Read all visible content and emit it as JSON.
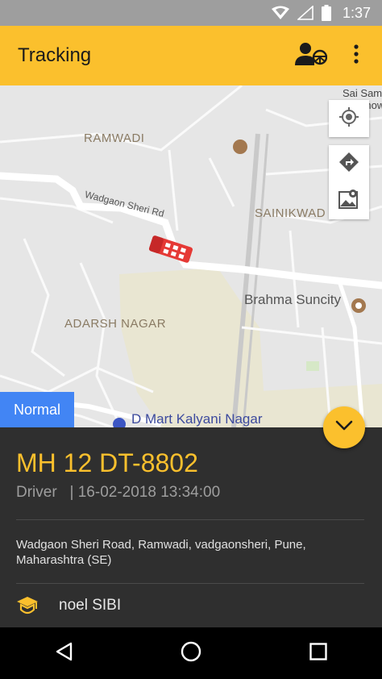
{
  "status_bar": {
    "time": "1:37",
    "icons": [
      "wifi-icon",
      "signal-icon",
      "battery-icon"
    ]
  },
  "app_bar": {
    "title": "Tracking",
    "actions": [
      "driver-icon",
      "more-vert-icon"
    ]
  },
  "map": {
    "labels": {
      "ramwadi": "RAMWADI",
      "sainikwadi": "SAINIKWAD",
      "adarsh_nagar": "ADARSH NAGAR",
      "brahma_suncity": "Brahma Suncity",
      "wadgaon_road": "Wadgaon Sheri Rd",
      "dmart": "D Mart Kalyani Nagar",
      "sai_sam": "Sai Sam",
      "chow": "Chow"
    },
    "controls": [
      "my-location-icon",
      "directions-icon",
      "map-search-icon"
    ],
    "map_type": "Normal"
  },
  "vehicle": {
    "plate": "MH 12 DT-8802",
    "role": "Driver",
    "timestamp": "16-02-2018 13:34:00",
    "separator": "|",
    "address": "Wadgaon Sheri Road, Ramwadi, vadgaonsheri, Pune, Maharashtra (SE)",
    "driver_name": "noel SIBI"
  },
  "colors": {
    "accent": "#fbc02d",
    "panel": "#2f2f2f",
    "map_type_badge": "#4285f4"
  }
}
